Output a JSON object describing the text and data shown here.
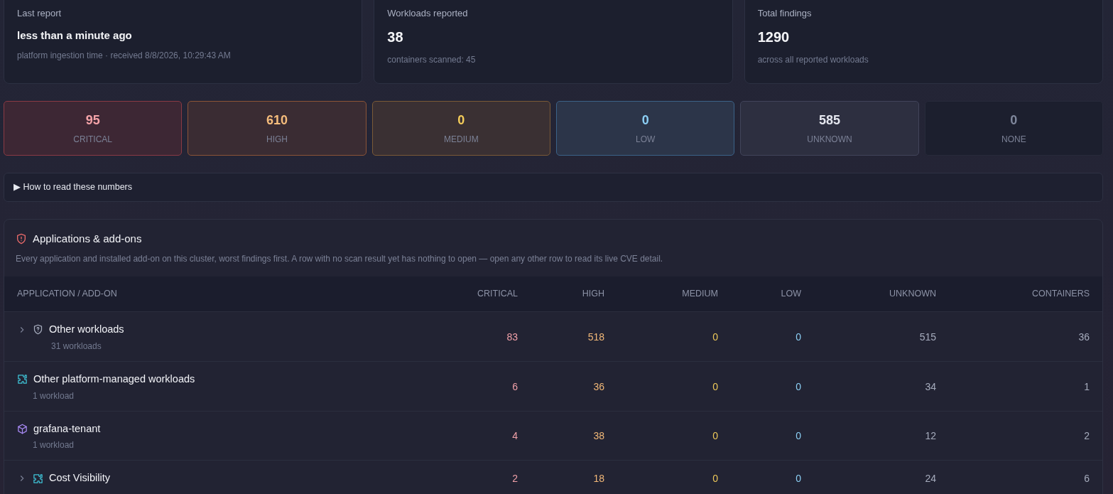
{
  "summary_cards": [
    {
      "label": "Last report",
      "value": "less than a minute ago",
      "note": "platform ingestion time · received 8/8/2026, 10:29:43 AM",
      "kind": "text"
    },
    {
      "label": "Workloads reported",
      "value": "38",
      "note": "containers scanned: 45",
      "kind": "number"
    },
    {
      "label": "Total findings",
      "value": "1290",
      "note": "across all reported workloads",
      "kind": "number"
    }
  ],
  "severity_tiles": [
    {
      "kind": "critical",
      "count": "95",
      "label": "CRITICAL"
    },
    {
      "kind": "high",
      "count": "610",
      "label": "HIGH"
    },
    {
      "kind": "medium",
      "count": "0",
      "label": "MEDIUM"
    },
    {
      "kind": "low",
      "count": "0",
      "label": "LOW"
    },
    {
      "kind": "unknown",
      "count": "585",
      "label": "UNKNOWN"
    },
    {
      "kind": "none",
      "count": "0",
      "label": "NONE"
    }
  ],
  "help_details": {
    "marker": "▶",
    "summary": "How to read these numbers",
    "expanded": false
  },
  "panel": {
    "title": "Applications & add-ons",
    "description": "Every application and installed add-on on this cluster, worst findings first. A row with no scan result yet has nothing to open — open any other row to read its live CVE detail.",
    "table": {
      "columns": [
        "APPLICATION / ADD-ON",
        "CRITICAL",
        "HIGH",
        "MEDIUM",
        "LOW",
        "UNKNOWN",
        "CONTAINERS"
      ],
      "rows": [
        {
          "expandable": true,
          "kind": "shield",
          "name": "Other workloads",
          "subtitle": "31 workloads",
          "critical": "83",
          "high": "518",
          "medium": "0",
          "low": "0",
          "unknown": "515",
          "containers": "36"
        },
        {
          "expandable": false,
          "kind": "puzzle",
          "name": "Other platform-managed workloads",
          "subtitle": "1 workload",
          "critical": "6",
          "high": "36",
          "medium": "0",
          "low": "0",
          "unknown": "34",
          "containers": "1"
        },
        {
          "expandable": false,
          "kind": "cube",
          "name": "grafana-tenant",
          "subtitle": "1 workload",
          "critical": "4",
          "high": "38",
          "medium": "0",
          "low": "0",
          "unknown": "12",
          "containers": "2"
        },
        {
          "expandable": true,
          "kind": "puzzle",
          "name": "Cost Visibility",
          "critical": "2",
          "high": "18",
          "medium": "0",
          "low": "0",
          "unknown": "24",
          "containers": "6"
        }
      ]
    }
  }
}
